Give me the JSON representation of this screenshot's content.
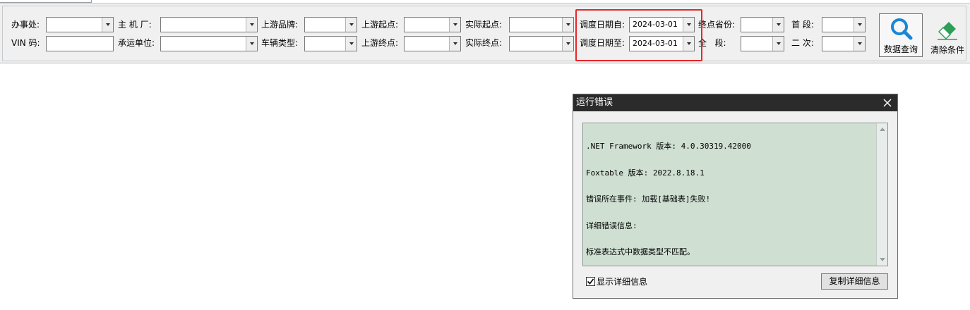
{
  "filters": {
    "office_label": "办事处:",
    "oem_label": "主 机 厂:",
    "upstream_brand_label": "上游品牌:",
    "upstream_start_label": "上游起点:",
    "actual_start_label": "实际起点:",
    "dispatch_date_from_label": "调度日期自:",
    "dispatch_date_from_value": "2024-03-01",
    "dest_province_label": "终点省份:",
    "first_segment_label": "首 段:",
    "vin_label": "VIN 码:",
    "carrier_label": "承运单位:",
    "vehicle_type_label": "车辆类型:",
    "upstream_end_label": "上游终点:",
    "actual_end_label": "实际终点:",
    "dispatch_date_to_label": "调度日期至:",
    "dispatch_date_to_value": "2024-03-01",
    "full_segment_label": "全   段:",
    "second_label": "二 次:"
  },
  "buttons": {
    "query_label": "数据查询",
    "clear_label": "清除条件"
  },
  "dialog": {
    "title": "运行错误",
    "lines": [
      ".NET Framework 版本: 4.0.30319.42000",
      "Foxtable 版本: 2022.8.18.1",
      "错误所在事件: 加载[基础表]失败!",
      "详细错误信息:",
      "标准表达式中数据类型不匹配。"
    ],
    "show_details_label": "显示详细信息",
    "show_details_checked": true,
    "copy_button_label": "复制详细信息"
  },
  "icons": {
    "query": "magnifier-icon",
    "clear": "eraser-icon",
    "close": "close-icon"
  },
  "colors": {
    "highlight_box": "#e8262a",
    "query_icon": "#1a86d6",
    "eraser_icon": "#2f9e58",
    "dialog_text_bg": "#cfe0d2",
    "dialog_title_bg": "#2b2b2b"
  }
}
